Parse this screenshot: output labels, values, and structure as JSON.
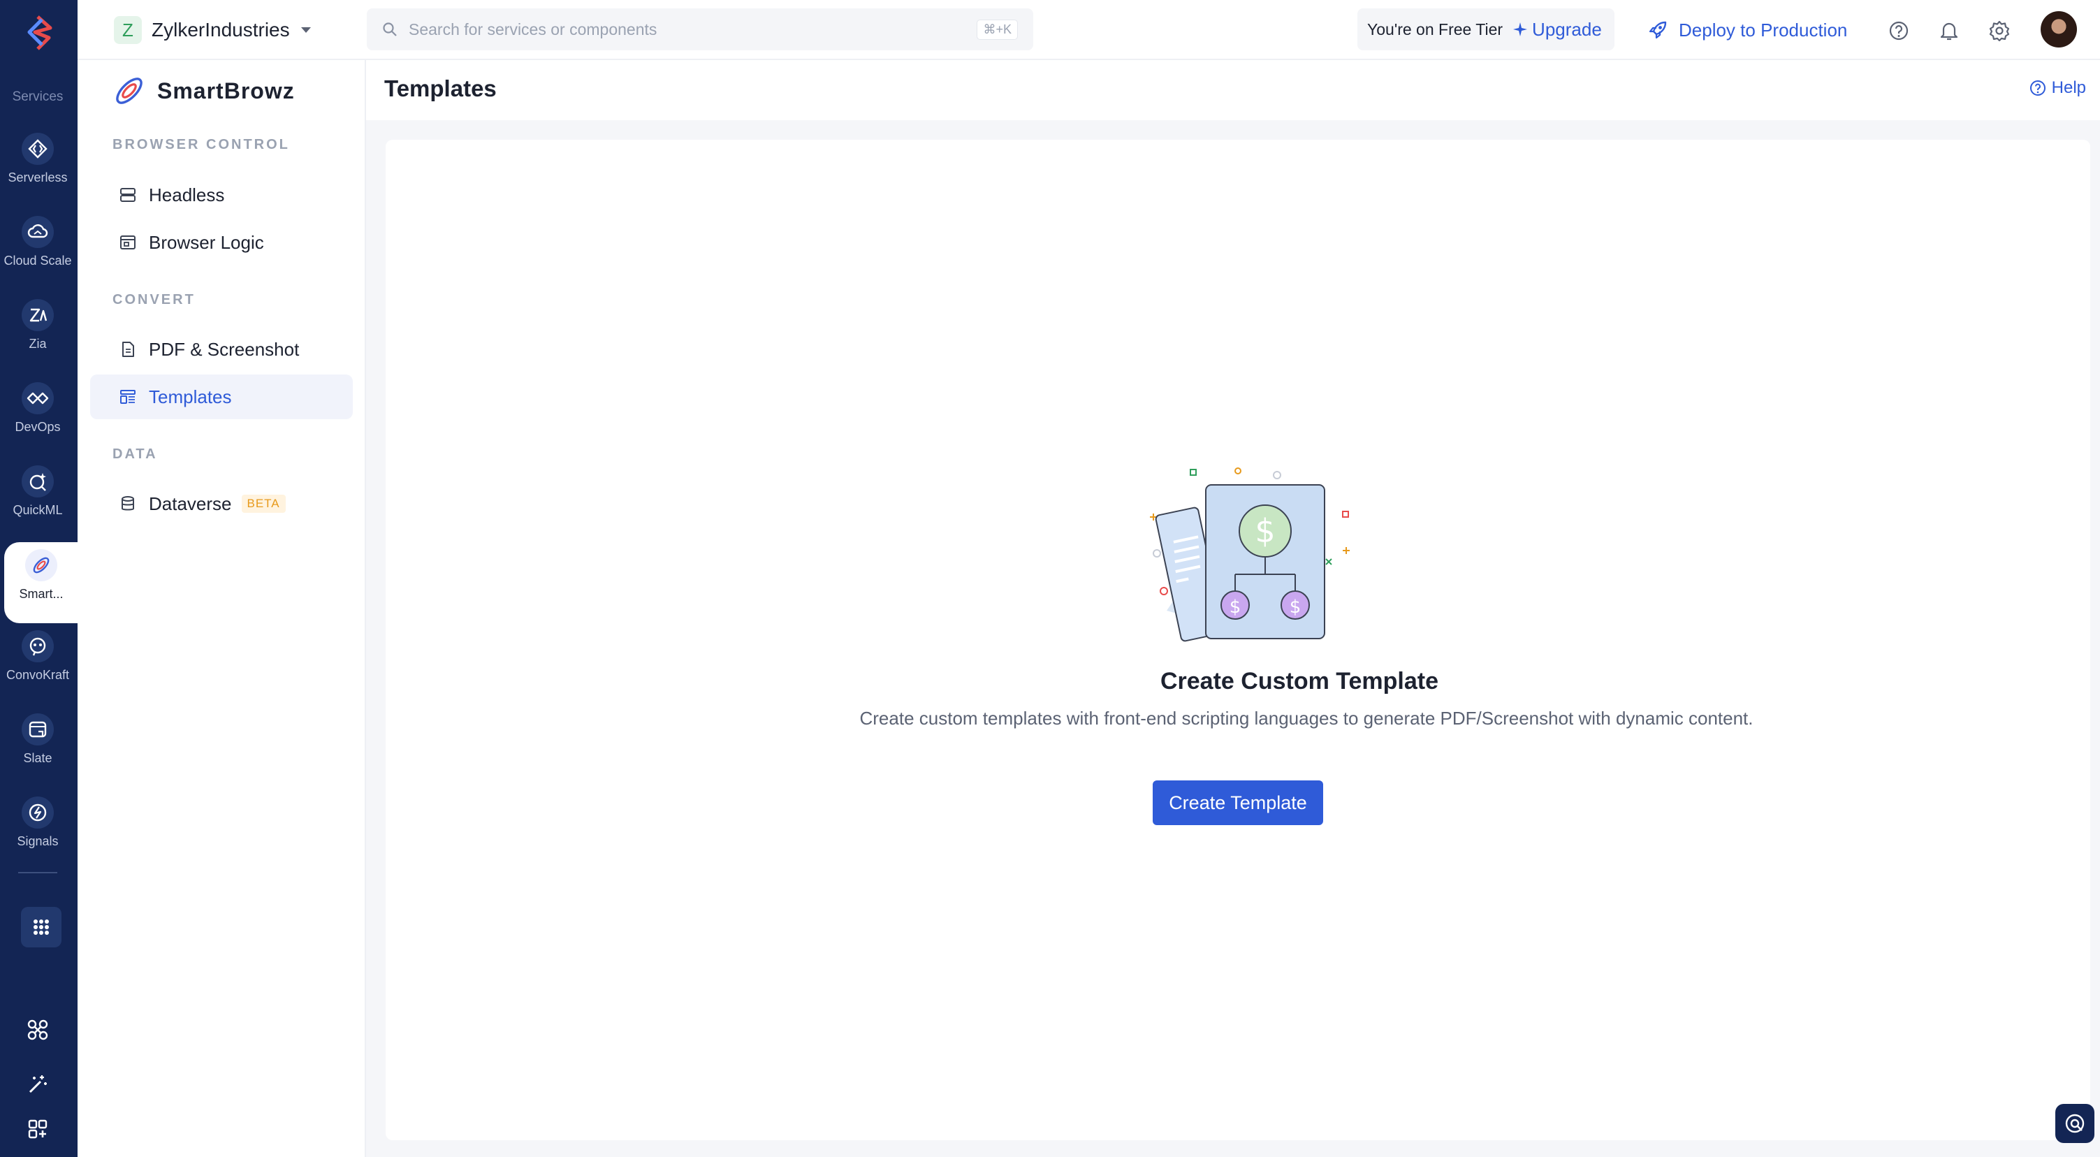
{
  "rail": {
    "services_label": "Services",
    "items": [
      {
        "label": "Serverless",
        "icon": "serverless-icon"
      },
      {
        "label": "Cloud Scale",
        "icon": "cloud-scale-icon"
      },
      {
        "label": "Zia",
        "icon": "zia-icon"
      },
      {
        "label": "DevOps",
        "icon": "devops-icon"
      },
      {
        "label": "QuickML",
        "icon": "quickml-icon"
      },
      {
        "label": "Smart...",
        "icon": "smartbrowz-icon"
      },
      {
        "label": "ConvoKraft",
        "icon": "convokraft-icon"
      },
      {
        "label": "Slate",
        "icon": "slate-icon"
      },
      {
        "label": "Signals",
        "icon": "signals-icon"
      }
    ]
  },
  "topbar": {
    "org_initial": "Z",
    "org_name": "ZylkerIndustries",
    "search_placeholder": "Search for services or components",
    "search_shortcut": "⌘+K",
    "tier_text": "You're on Free Tier",
    "upgrade_label": "Upgrade",
    "deploy_label": "Deploy to Production"
  },
  "sidebar": {
    "brand": "SmartBrowz",
    "sections": [
      {
        "title": "BROWSER CONTROL",
        "items": [
          "Headless",
          "Browser Logic"
        ]
      },
      {
        "title": "CONVERT",
        "items": [
          "PDF & Screenshot",
          "Templates"
        ]
      },
      {
        "title": "DATA",
        "items": [
          "Dataverse"
        ]
      }
    ],
    "beta_badge": "BETA"
  },
  "main": {
    "title": "Templates",
    "help_label": "Help",
    "empty_title": "Create Custom Template",
    "empty_description": "Create custom templates with front-end scripting languages to generate PDF/Screenshot with dynamic content.",
    "create_button": "Create Template"
  },
  "colors": {
    "rail_bg": "#132554",
    "accent": "#2f5bd8",
    "beta": "#e79a1c"
  }
}
